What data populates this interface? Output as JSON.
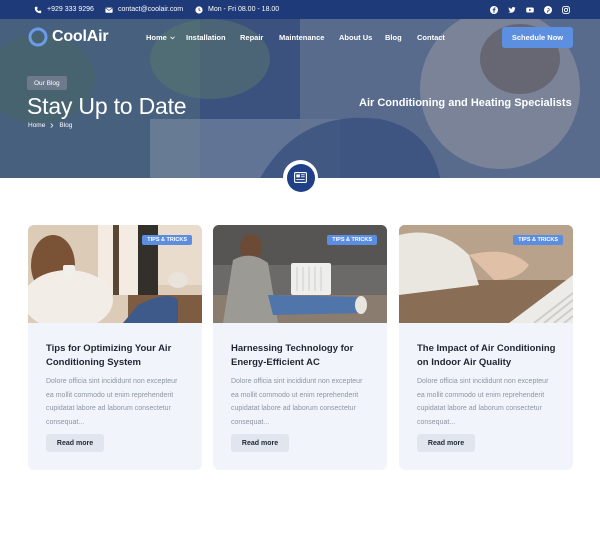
{
  "topbar": {
    "phone": "+929 333 9296",
    "email": "contact@coolair.com",
    "hours": "Mon - Fri 08.00 - 18.00",
    "social": [
      "facebook-icon",
      "twitter-icon",
      "youtube-icon",
      "pinterest-icon",
      "instagram-icon"
    ]
  },
  "brand": {
    "name": "CoolAir",
    "accent": "#5d8fe0",
    "dark": "#1f3a78"
  },
  "nav": {
    "items": [
      "Home",
      "Installation",
      "Repair",
      "Maintenance",
      "About Us",
      "Blog",
      "Contact"
    ],
    "cta": "Schedule Now"
  },
  "hero": {
    "badge": "Our Blog",
    "title": "Stay Up to Date",
    "breadcrumb": [
      "Home",
      "Blog"
    ],
    "tagline": "Air Conditioning and Heating Specialists"
  },
  "posts": [
    {
      "tag": "TIPS & TRICKS",
      "title": "Tips for Optimizing Your Air Conditioning System",
      "excerpt": "Dolore officia sint incididunt non excepteur ea mollit commodo ut enim reprehenderit cupidatat labore ad laborum consectetur consequat...",
      "button": "Read more"
    },
    {
      "tag": "TIPS & TRICKS",
      "title": "Harnessing Technology for Energy-Efficient AC",
      "excerpt": "Dolore officia sint incididunt non excepteur ea mollit commodo ut enim reprehenderit cupidatat labore ad laborum consectetur consequat...",
      "button": "Read more"
    },
    {
      "tag": "TIPS & TRICKS",
      "title": "The Impact of Air Conditioning on Indoor Air Quality",
      "excerpt": "Dolore officia sint incididunt non excepteur ea mollit commodo ut enim reprehenderit cupidatat labore ad laborum consectetur consequat...",
      "button": "Read more"
    }
  ]
}
